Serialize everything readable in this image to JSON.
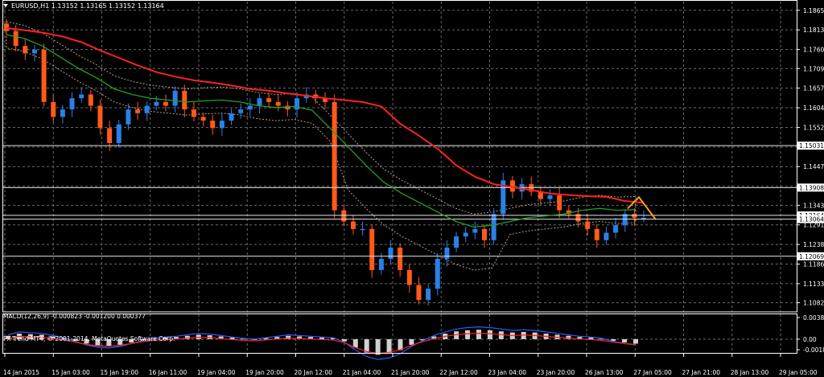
{
  "header": {
    "symbol_line": "EURUSD,H1  1.13152 1.13165 1.13152 1.13164"
  },
  "watermark": "FX-Trend MT4, © 2001-2014, MetaQuotes Software Corp.",
  "chart_data": [
    {
      "type": "candlestick",
      "title": "EURUSD,H1",
      "quote": {
        "open": 1.13152,
        "high": 1.13165,
        "low": 1.13152,
        "close": 1.13164
      },
      "y_ticks": [
        "1.18655",
        "1.18130",
        "1.17605",
        "1.17095",
        "1.16570",
        "1.16045",
        "1.15520",
        "1.14995",
        "1.14470",
        "1.13945",
        "1.13435",
        "1.12910",
        "1.12385",
        "1.11860",
        "1.11335",
        "1.10825"
      ],
      "ylim": [
        1.1058,
        1.1893
      ],
      "price_boxes": [
        {
          "label": "1.15031",
          "value": 1.15031
        },
        {
          "label": "1.13908",
          "value": 1.13908
        },
        {
          "label": "1.13164",
          "value": 1.13164
        },
        {
          "label": "1.13064",
          "value": 1.13064
        },
        {
          "label": "1.12069",
          "value": 1.12069
        }
      ],
      "x_ticks": [
        "14 Jan 2015",
        "15 Jan 03:00",
        "15 Jan 19:00",
        "16 Jan 11:00",
        "19 Jan 04:00",
        "19 Jan 20:00",
        "20 Jan 12:00",
        "21 Jan 04:00",
        "21 Jan 20:00",
        "22 Jan 12:00",
        "23 Jan 04:00",
        "23 Jan 20:00",
        "26 Jan 13:00",
        "27 Jan 05:00",
        "27 Jan 21:00",
        "28 Jan 13:00",
        "29 Jan 05:00"
      ],
      "series": [
        {
          "name": "EURUSD close (approx.)",
          "values": [
            1.181,
            1.177,
            1.175,
            1.176,
            1.162,
            1.158,
            1.16,
            1.163,
            1.164,
            1.161,
            1.155,
            1.151,
            1.156,
            1.16,
            1.159,
            1.161,
            1.162,
            1.161,
            1.165,
            1.16,
            1.158,
            1.157,
            1.155,
            1.157,
            1.159,
            1.16,
            1.161,
            1.163,
            1.162,
            1.161,
            1.16,
            1.163,
            1.164,
            1.163,
            1.162,
            1.133,
            1.13,
            1.128,
            1.128,
            1.117,
            1.12,
            1.123,
            1.117,
            1.113,
            1.109,
            1.112,
            1.12,
            1.123,
            1.126,
            1.127,
            1.128,
            1.125,
            1.132,
            1.141,
            1.138,
            1.14,
            1.138,
            1.136,
            1.137,
            1.133,
            1.132,
            1.13,
            1.128,
            1.125,
            1.127,
            1.129,
            1.132,
            1.131,
            1.131
          ]
        },
        {
          "name": "moving average (red)",
          "values": [
            1.1818,
            1.1812,
            1.1805,
            1.1795,
            1.178,
            1.1758,
            1.1738,
            1.1718,
            1.17,
            1.1688,
            1.1678,
            1.1672,
            1.1664,
            1.1655,
            1.165,
            1.1643,
            1.1637,
            1.163,
            1.1625,
            1.162,
            1.1608,
            1.1562,
            1.153,
            1.1495,
            1.145,
            1.142,
            1.14,
            1.1392,
            1.1384,
            1.1375,
            1.1371,
            1.1368,
            1.1366,
            1.1355,
            1.135
          ]
        },
        {
          "name": "moving average (green)",
          "values": [
            1.18,
            1.179,
            1.177,
            1.174,
            1.171,
            1.1685,
            1.1655,
            1.164,
            1.163,
            1.1625,
            1.162,
            1.1623,
            1.1625,
            1.162,
            1.161,
            1.1605,
            1.1608,
            1.1598,
            1.155,
            1.15,
            1.145,
            1.1405,
            1.1375,
            1.135,
            1.1325,
            1.13,
            1.1285,
            1.129,
            1.13,
            1.131,
            1.1315,
            1.132,
            1.133,
            1.1335,
            1.133,
            1.1332
          ]
        }
      ]
    },
    {
      "type": "bar",
      "title": "MACD(12,26,9) -0.000823 -0.001200 0.000377",
      "y_ticks": [
        "0.003884",
        "0.00",
        "-0.00189"
      ],
      "ylim": [
        -0.0026,
        0.0046
      ],
      "series": [
        {
          "name": "MACD histogram (approx.)",
          "values": [
            0.0006,
            0.001,
            0.0009,
            0.0008,
            0.0005,
            0.0002,
            -0.0003,
            -0.0008,
            -0.0011,
            -0.0012,
            -0.001,
            -0.0006,
            -0.0002,
            0.0001,
            0.0003,
            0.0004,
            0.0006,
            0.0008,
            0.0007,
            0.0005,
            0.0003,
            0.0001,
            0.0,
            0.0002,
            0.0004,
            0.0006,
            0.0005,
            0.0004,
            0.0003,
            0.0002,
            -0.0004,
            -0.0015,
            -0.0024,
            -0.0028,
            -0.0026,
            -0.002,
            -0.001,
            -0.0002,
            0.0005,
            0.001,
            0.0014,
            0.0016,
            0.0017,
            0.0016,
            0.0014,
            0.0012,
            0.0013,
            0.0012,
            0.001,
            0.0008,
            0.0006,
            0.0004,
            0.0003,
            0.0001,
            -0.0003,
            -0.0006,
            -0.0008
          ]
        }
      ]
    }
  ]
}
